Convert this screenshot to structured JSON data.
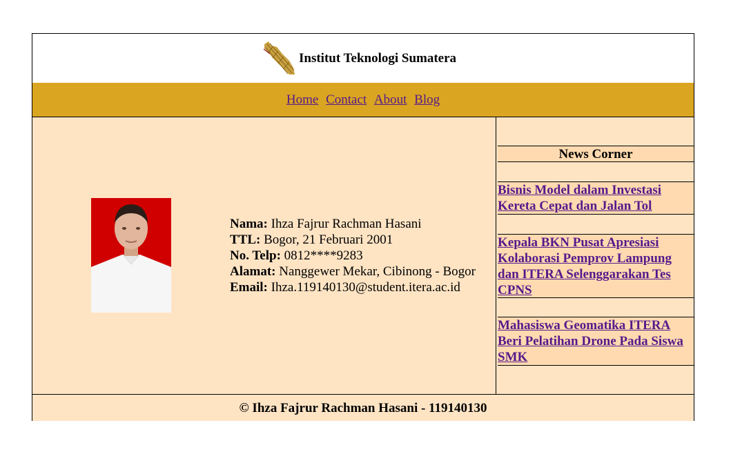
{
  "header": {
    "title": "Institut Teknologi Sumatera",
    "logo_icon": "itera-logo-icon"
  },
  "nav": {
    "items": [
      {
        "label": "Home"
      },
      {
        "label": "Contact"
      },
      {
        "label": "About"
      },
      {
        "label": "Blog"
      }
    ]
  },
  "profile": {
    "photo_icon": "profile-photo",
    "fields": [
      {
        "label": "Nama:",
        "value": "Ihza Fajrur Rachman Hasani"
      },
      {
        "label": "TTL:",
        "value": "Bogor, 21 Februari 2001"
      },
      {
        "label": "No. Telp:",
        "value": "0812****9283"
      },
      {
        "label": "Alamat:",
        "value": "Nanggewer Mekar, Cibinong - Bogor"
      },
      {
        "label": "Email:",
        "value": "Ihza.119140130@student.itera.ac.id"
      }
    ]
  },
  "sidebar": {
    "title": "News Corner",
    "news": [
      {
        "title": "Bisnis Model dalam Investasi Kereta Cepat dan Jalan Tol"
      },
      {
        "title": "Kepala BKN Pusat Apresiasi Kolaborasi Pemprov Lampung dan ITERA Selenggarakan Tes CPNS"
      },
      {
        "title": "Mahasiswa Geomatika ITERA Beri Pelatihan Drone Pada Siswa SMK"
      }
    ]
  },
  "footer": {
    "text": "© Ihza Fajrur Rachman Hasani - 119140130"
  },
  "colors": {
    "nav_bg": "#daa520",
    "content_bg": "#ffe4c4",
    "news_bg": "#ffdab0",
    "link": "#551a8b"
  }
}
